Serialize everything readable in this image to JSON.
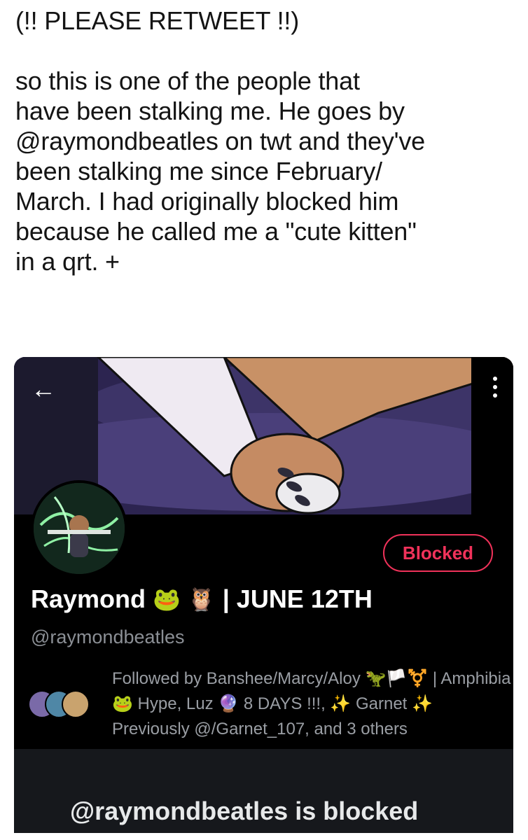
{
  "tweet": {
    "text": "(!! PLEASE RETWEET !!)\n\nso this is one of the people that\nhave been stalking me. He goes by\n@raymondbeatles on twt and they've\nbeen stalking me since February/\nMarch. I had originally blocked him\nbecause he called me a \"cute kitten\"\nin a qrt. +"
  },
  "profile": {
    "back_icon": "←",
    "more_icon": "more-vertical-icon",
    "blocked_label": "Blocked",
    "name": "Raymond",
    "name_emoji_1": "🐸",
    "name_emoji_2": "🦉",
    "name_suffix": "| JUNE 12TH",
    "handle": "@raymondbeatles",
    "followed_by": "Followed by Banshee/Marcy/Aloy 🦖🏳️⚧️ | Amphibia🐸 Hype, Luz 🔮 8 DAYS !!!, ✨ Garnet ✨ Previously @/Garnet_107, and 3 others",
    "blocked_message": "@raymondbeatles is blocked"
  },
  "colors": {
    "accent_red": "#f0325a",
    "card_bg": "#000000",
    "muted_text": "#8b8f95"
  }
}
